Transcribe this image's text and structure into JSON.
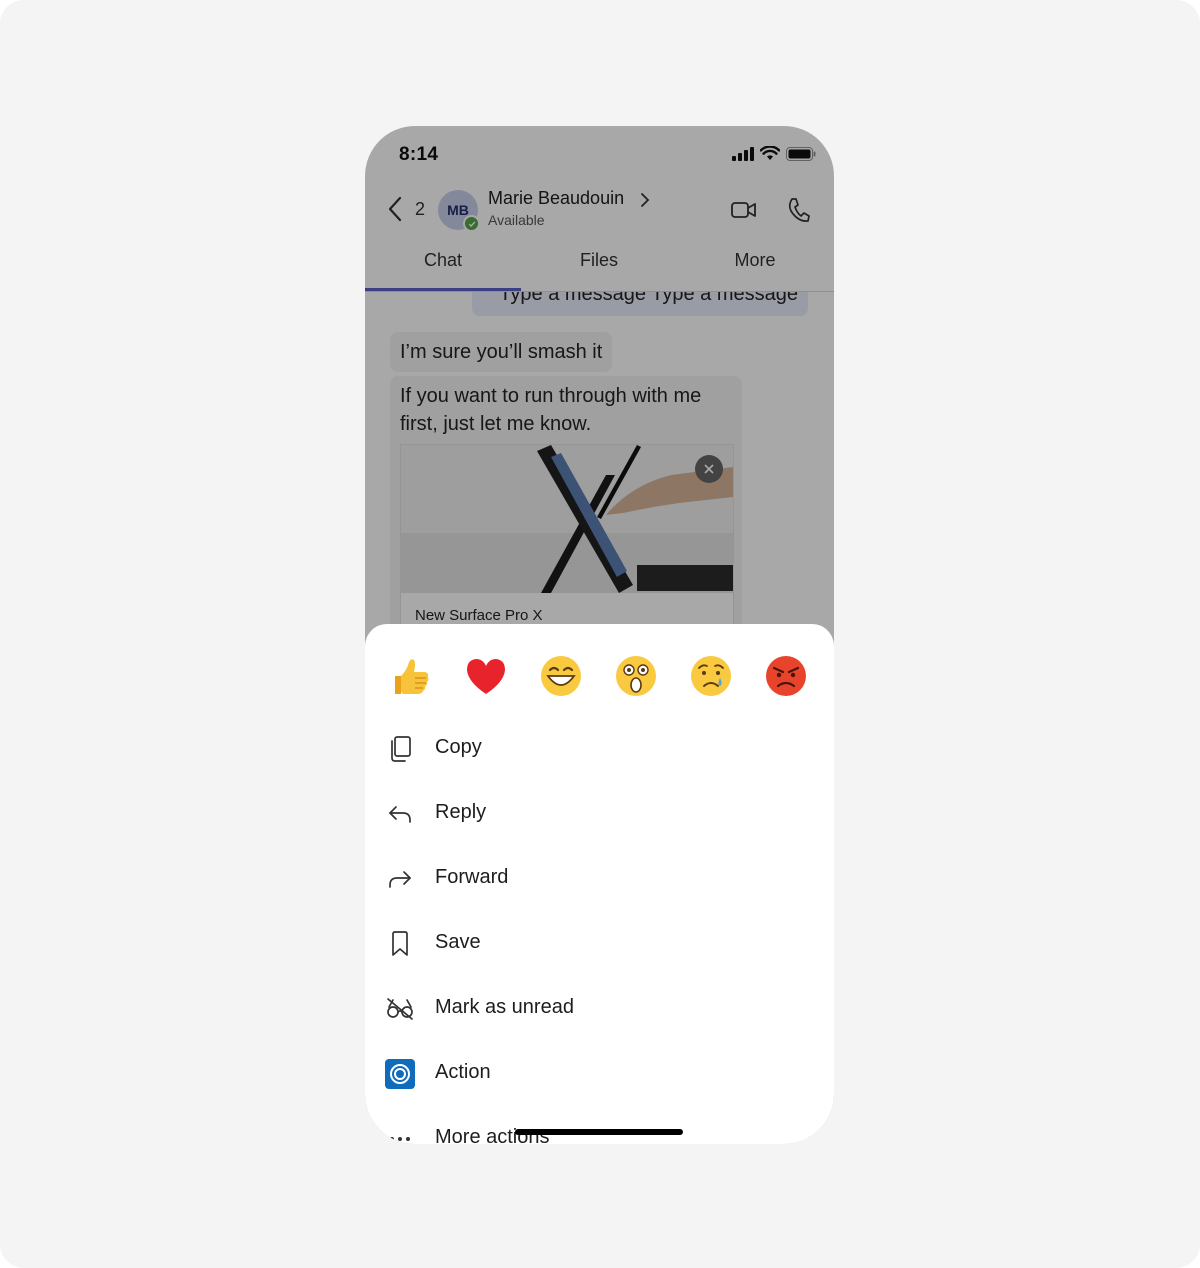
{
  "status_bar": {
    "time": "8:14"
  },
  "header": {
    "back_count": "2",
    "avatar_initials": "MB",
    "contact_name": "Marie Beaudouin",
    "contact_status": "Available"
  },
  "tabs": [
    {
      "label": "Chat",
      "active": true
    },
    {
      "label": "Files",
      "active": false
    },
    {
      "label": "More",
      "active": false
    }
  ],
  "messages": {
    "outgoing": "Type a message Type a message",
    "incoming_1": "I’m sure you’ll smash it",
    "incoming_2": "If you want to run through with me first, just let me know.",
    "link_preview_title": "New Surface Pro X"
  },
  "reactions": [
    "thumbs-up",
    "heart",
    "grinning-face",
    "astonished-face",
    "sad-face",
    "angry-face"
  ],
  "menu": [
    {
      "label": "Copy",
      "icon": "copy-icon"
    },
    {
      "label": "Reply",
      "icon": "reply-icon"
    },
    {
      "label": "Forward",
      "icon": "forward-icon"
    },
    {
      "label": "Save",
      "icon": "bookmark-icon"
    },
    {
      "label": "Mark as unread",
      "icon": "unread-icon"
    },
    {
      "label": "Action",
      "icon": "action-app-icon"
    },
    {
      "label": "More actions",
      "icon": "more-icon"
    }
  ],
  "colors": {
    "accent": "#5b5fc7",
    "presence": "#57a548",
    "action_app": "#0f6cbd"
  }
}
